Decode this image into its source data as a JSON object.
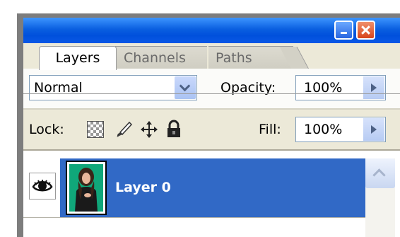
{
  "tabs": {
    "layers": "Layers",
    "channels": "Channels",
    "paths": "Paths"
  },
  "blend_mode": {
    "value": "Normal"
  },
  "opacity": {
    "label": "Opacity:",
    "value": "100%"
  },
  "lock": {
    "label": "Lock:"
  },
  "fill": {
    "label": "Fill:",
    "value": "100%"
  },
  "layers": [
    {
      "name": "Layer 0",
      "visible": true,
      "selected": true
    }
  ],
  "colors": {
    "titlebar": "#0a5fe0",
    "selected_layer": "#3169c6",
    "panel_bg": "#ece9d8"
  },
  "icons": {
    "eye": "eye-icon",
    "lock_transparent": "lock-transparent-pixels-icon",
    "lock_image": "lock-image-pixels-icon",
    "lock_position": "lock-position-icon",
    "lock_all": "lock-all-icon",
    "palette_menu": "palette-menu-icon",
    "minimize": "minimize-icon",
    "close": "close-icon"
  }
}
